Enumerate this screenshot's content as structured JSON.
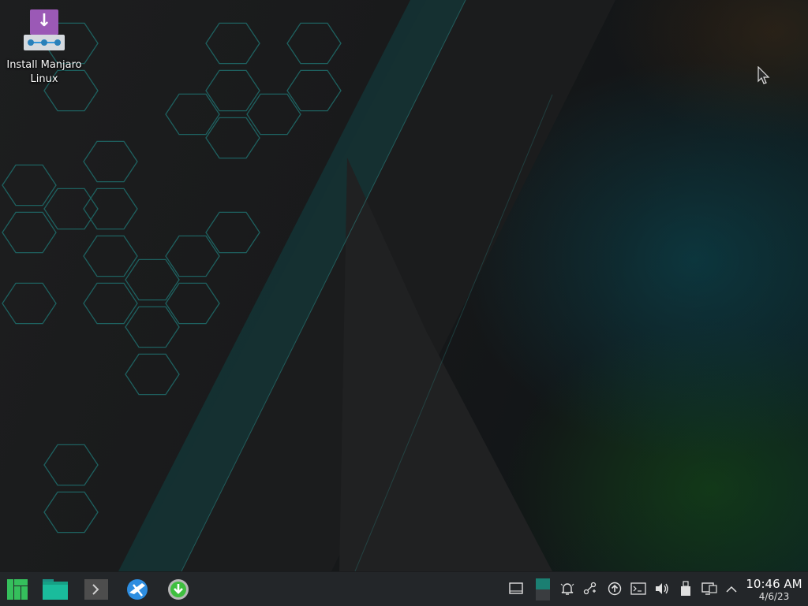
{
  "desktop": {
    "icons": [
      {
        "label": "Install Manjaro Linux",
        "icon": "install-manjaro-icon"
      }
    ]
  },
  "taskbar": {
    "launchers": [
      {
        "icon": "manjaro-menu-icon"
      },
      {
        "icon": "folder-icon"
      },
      {
        "icon": "terminal-icon"
      },
      {
        "icon": "web-browser-icon"
      },
      {
        "icon": "installer-icon"
      }
    ],
    "tray": [
      "show-desktop-icon",
      "pager-icon",
      "notifications-icon",
      "network-share-icon",
      "updates-icon",
      "console-icon",
      "volume-icon",
      "usb-device-icon",
      "display-icon",
      "expand-tray-icon"
    ],
    "clock": {
      "time": "10:46 AM",
      "date": "4/6/23"
    }
  },
  "colors": {
    "taskbar": "#232629",
    "accent": "#35bf5c",
    "hex_outline": "#1e6b6b"
  }
}
